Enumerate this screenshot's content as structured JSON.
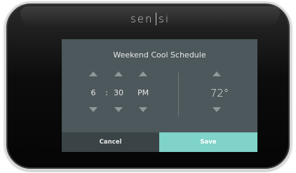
{
  "device": {
    "brand_left": "sen",
    "brand_right": "si"
  },
  "screen": {
    "title": "Weekend Cool Schedule",
    "time": {
      "hour": "6",
      "separator": ":",
      "minute": "30",
      "period": "PM"
    },
    "temperature": "72°"
  },
  "buttons": {
    "cancel_label": "Cancel",
    "save_label": "Save"
  },
  "colors": {
    "screen_bg": "#4d585c",
    "cancel_bg": "#3a4447",
    "save_bg": "#7fd3c8",
    "arrow": "#8f989b"
  },
  "icons": {
    "increment": "arrow-up-icon",
    "decrement": "arrow-down-icon"
  }
}
